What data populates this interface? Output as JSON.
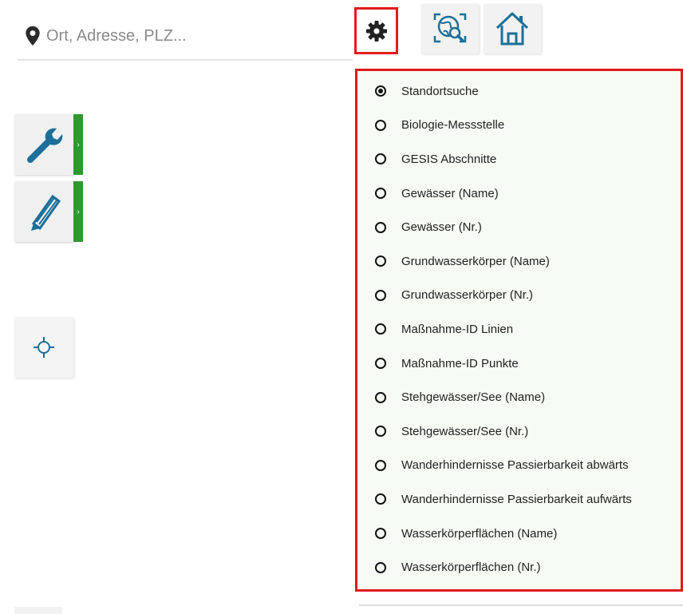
{
  "search": {
    "placeholder": "Ort, Adresse, PLZ..."
  },
  "icons": {
    "pin": "map-marker-icon",
    "gear": "gear-icon",
    "globe": "globe-search-icon",
    "home": "home-icon",
    "wrench": "wrench-icon",
    "pencil": "pencil-icon",
    "locate": "crosshair-icon"
  },
  "colors": {
    "highlight": "#e11b1b",
    "accent_green": "#2e9a2e",
    "icon_blue": "#1d6f99",
    "menu_bg": "#f6fbf3"
  },
  "side_tools": {
    "handle_glyph": "›"
  },
  "search_menu": {
    "selected": "Standortsuche",
    "options": [
      "Standortsuche",
      "Biologie-Messstelle",
      "GESIS Abschnitte",
      "Gewässer (Name)",
      "Gewässer (Nr.)",
      "Grundwasserkörper (Name)",
      "Grundwasserkörper (Nr.)",
      "Maßnahme-ID Linien",
      "Maßnahme-ID Punkte",
      "Stehgewässer/See (Name)",
      "Stehgewässer/See (Nr.)",
      "Wanderhindernisse Passierbarkeit abwärts",
      "Wanderhindernisse Passierbarkeit aufwärts",
      "Wasserkörperflächen (Name)",
      "Wasserkörperflächen (Nr.)"
    ]
  }
}
